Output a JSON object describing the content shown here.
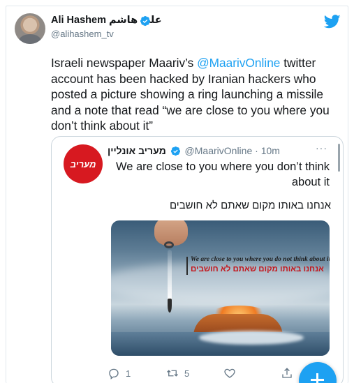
{
  "tweet": {
    "author_name": "Ali Hashem علي هاشم",
    "handle": "@alihashem_tv",
    "text_before": "Israeli newspaper Maariv’s ",
    "mention": "@MaarivOnline",
    "text_after": " twitter account has been hacked by Iranian hackers who posted a picture showing a ring launching a missile and a note that read “we are close to you where you don’t think about it”"
  },
  "quoted": {
    "avatar_text": "מעריב",
    "name": "מעריב אונליין",
    "handle": "@MaarivOnline",
    "time": "10m",
    "more": "···",
    "text_en": "We are close to you where you don’t think about it",
    "text_he": "אנחנו באותו מקום שאתם לא חושבים",
    "media": {
      "caption_en": "We are close to you where you do not think about it",
      "caption_he": "אנחנו באותו מקום שאתם לא חושבים"
    },
    "actions": {
      "reply_count": "1",
      "retweet_count": "5"
    }
  },
  "icons": {
    "verified": "verified-badge-icon",
    "brand": "twitter-bird-icon",
    "reply": "reply-icon",
    "retweet": "retweet-icon",
    "like": "heart-icon",
    "share": "share-icon",
    "compose": "plus-icon"
  },
  "colors": {
    "accent": "#1da1f2",
    "maariv_red": "#d71920",
    "secondary_text": "#657786"
  }
}
